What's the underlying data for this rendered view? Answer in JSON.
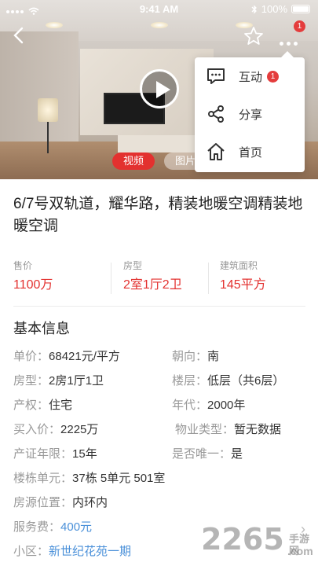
{
  "status_bar": {
    "time": "9:41 AM",
    "battery": "100%"
  },
  "hero": {
    "tabs": [
      {
        "label": "视频",
        "active": true
      },
      {
        "label": "图片",
        "active": false
      }
    ],
    "more_badge": "1"
  },
  "popup_menu": {
    "items": [
      {
        "label": "互动",
        "icon": "chat-icon",
        "badge": "1"
      },
      {
        "label": "分享",
        "icon": "share-icon"
      },
      {
        "label": "首页",
        "icon": "home-icon"
      }
    ]
  },
  "title": "6/7号双轨道，耀华路，精装地暖空调精装地暖空调",
  "stats": [
    {
      "label": "售价",
      "value": "1100万"
    },
    {
      "label": "房型",
      "value": "2室1厅2卫"
    },
    {
      "label": "建筑面积",
      "value": "145平方"
    }
  ],
  "basic_info": {
    "title": "基本信息",
    "rows": [
      {
        "left": {
          "key": "单价：",
          "value": "68421元/平方"
        },
        "right": {
          "key": "朝向：",
          "value": "南"
        }
      },
      {
        "left": {
          "key": "房型：",
          "value": "2房1厅1卫"
        },
        "right": {
          "key": "楼层：",
          "value": "低层（共6层）"
        }
      },
      {
        "left": {
          "key": "产权：",
          "value": "住宅"
        },
        "right": {
          "key": "年代：",
          "value": "2000年"
        }
      },
      {
        "left": {
          "key": "买入价：",
          "value": "2225万"
        },
        "right": {
          "key": "物业类型：",
          "value": "暂无数据"
        }
      },
      {
        "left": {
          "key": "产证年限：",
          "value": "15年"
        },
        "right": {
          "key": "是否唯一：",
          "value": "是"
        }
      },
      {
        "left": {
          "key": "楼栋单元：",
          "value": "37栋 5单元 501室"
        }
      },
      {
        "left": {
          "key": "房源位置：",
          "value": "内环内"
        }
      },
      {
        "left": {
          "key": "服务费：",
          "value": "400元"
        }
      },
      {
        "left": {
          "key": "小区：",
          "value": "新世纪花苑一期"
        }
      }
    ]
  },
  "watermark": {
    "brand": "2265",
    "domain": ".com",
    "sub": "手游网"
  },
  "colors": {
    "accent": "#e3312f",
    "link": "#4a90d9",
    "muted": "#999999"
  }
}
